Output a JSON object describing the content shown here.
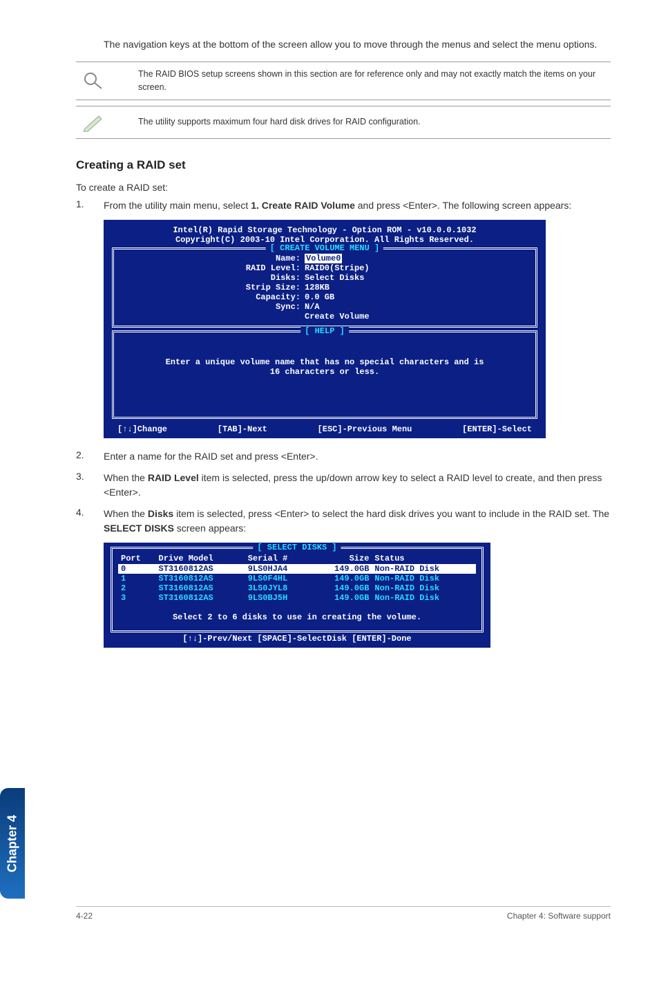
{
  "intro": "The navigation keys at the bottom of the screen allow you to move through the menus and select the menu options.",
  "note1": "The RAID BIOS setup screens shown in this section are for reference only and may not exactly match the items on your screen.",
  "note2": "The utility supports maximum four hard disk drives for RAID configuration.",
  "section_title": "Creating a RAID set",
  "section_sub": "To create a RAID set:",
  "step1_pre": "From the utility main menu, select ",
  "step1_bold": "1. Create RAID Volume",
  "step1_post": " and press <Enter>. The following screen appears:",
  "bios_top1": "Intel(R) Rapid Storage Technology - Option ROM - v10.0.0.1032",
  "bios_top2": "Copyright(C) 2003-10 Intel Corporation.  All Rights Reserved.",
  "menu_title": "[ CREATE VOLUME MENU ]",
  "f_name_l": "Name:",
  "f_name_v": "Volume0",
  "f_level_l": "RAID Level:",
  "f_level_v": "RAID0(Stripe)",
  "f_disks_l": "Disks:",
  "f_disks_v": "Select Disks",
  "f_strip_l": "Strip Size:",
  "f_strip_v": "128KB",
  "f_cap_l": "Capacity:",
  "f_cap_v": "0.0   GB",
  "f_sync_l": "Sync:",
  "f_sync_v": "N/A",
  "f_create": "Create Volume",
  "help_title": "[ HELP ]",
  "help1": "Enter a unique volume name that has no special characters and is",
  "help2": "16 characters or less.",
  "nav1": "[↑↓]Change",
  "nav2": "[TAB]-Next",
  "nav3": "[ESC]-Previous Menu",
  "nav4": "[ENTER]-Select",
  "step2": "Enter a name for the RAID set and press <Enter>.",
  "step3_pre": "When the ",
  "step3_bold": "RAID Level",
  "step3_post": " item is selected, press the up/down arrow key to select a RAID level to create, and then press <Enter>.",
  "step4_pre": "When the ",
  "step4_bold": "Disks",
  "step4_mid": " item is selected, press <Enter> to select the hard disk drives you want to include in the RAID set. The ",
  "step4_bold2": "SELECT DISKS",
  "step4_post": " screen appears:",
  "sd_title": "[ SELECT DISKS ]",
  "sd_h_port": "Port",
  "sd_h_model": "Drive Model",
  "sd_h_serial": "Serial #",
  "sd_h_size": "Size",
  "sd_h_status": "Status",
  "rows": [
    {
      "p": "0",
      "m": "ST3160812AS",
      "s": "9LS0HJA4",
      "sz": "149.0GB",
      "st": "Non-RAID Disk"
    },
    {
      "p": "1",
      "m": "ST3160812AS",
      "s": "9LS0F4HL",
      "sz": "149.0GB",
      "st": "Non-RAID Disk"
    },
    {
      "p": "2",
      "m": "ST3160812AS",
      "s": "3LS0JYL8",
      "sz": "149.0GB",
      "st": "Non-RAID Disk"
    },
    {
      "p": "3",
      "m": "ST3160812AS",
      "s": "9LS0BJ5H",
      "sz": "149.0GB",
      "st": "Non-RAID Disk"
    }
  ],
  "sd_msg": "Select 2 to 6 disks to use in creating the volume.",
  "sd_nav": "[↑↓]-Prev/Next [SPACE]-SelectDisk [ENTER]-Done",
  "side_tab": "Chapter 4",
  "footer_l": "4-22",
  "footer_r": "Chapter 4: Software support"
}
